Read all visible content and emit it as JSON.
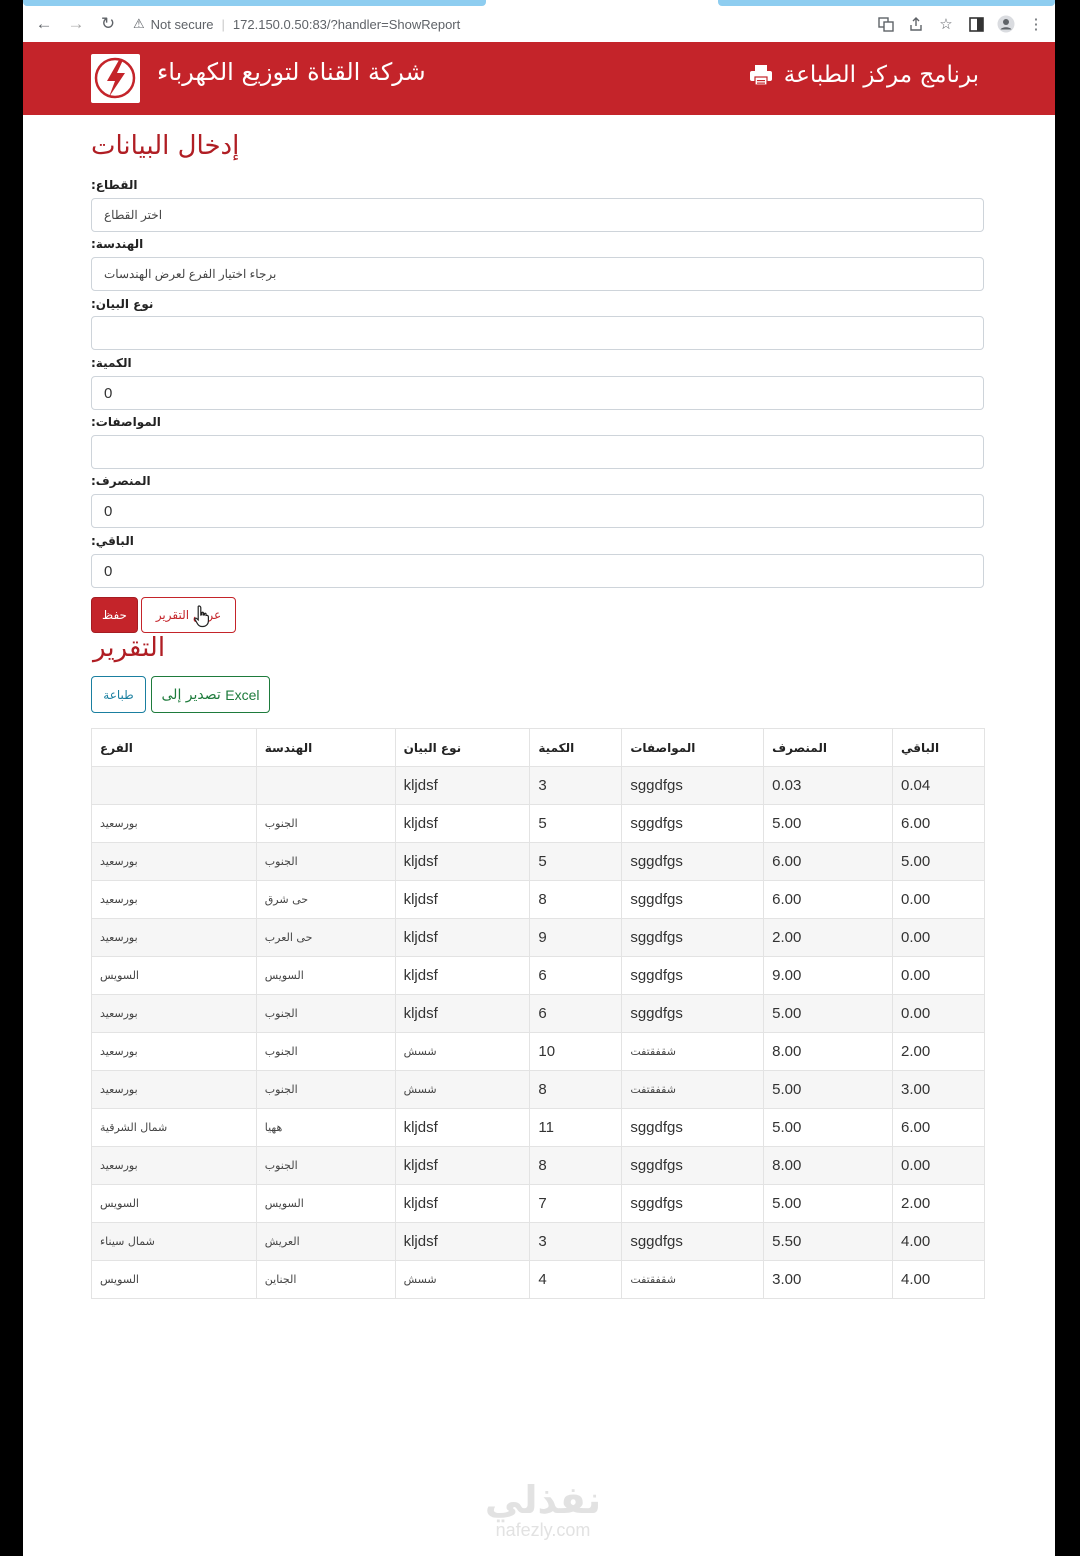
{
  "browser": {
    "security": "Not secure",
    "url": "172.150.0.50:83/?handler=ShowReport"
  },
  "header": {
    "company": "شركة القناة لتوزيع الكهرباء",
    "program": "برنامج مركز الطباعة",
    "brand_color": "#c4242a"
  },
  "form": {
    "title": "إدخال البيانات",
    "sector": {
      "label": "القطاع:",
      "value": "اختر القطاع"
    },
    "engineering": {
      "label": "الهندسة:",
      "value": "برجاء اختيار الفرع لعرض الهندسات"
    },
    "data_type": {
      "label": "نوع البيان:",
      "value": ""
    },
    "quantity": {
      "label": "الكمية:",
      "value": "0"
    },
    "specs": {
      "label": "المواصفات:",
      "value": ""
    },
    "spent": {
      "label": "المنصرف:",
      "value": "0"
    },
    "remaining": {
      "label": "الباقي:",
      "value": "0"
    },
    "save_label": "حفظ",
    "show_report_label": "عرض التقرير"
  },
  "report": {
    "title": "التقرير",
    "print_label": "طباعة",
    "export_label_en": "Excel",
    "export_label_ar": "تصدير إلى",
    "columns": [
      "الفرع",
      "الهندسة",
      "نوع البيان",
      "الكمية",
      "المواصفات",
      "المنصرف",
      "الباقي"
    ],
    "rows": [
      [
        "",
        "",
        "kljdsf",
        "3",
        "sggdfgs",
        "0.03",
        "0.04"
      ],
      [
        "بورسعيد",
        "الجنوب",
        "kljdsf",
        "5",
        "sggdfgs",
        "5.00",
        "6.00"
      ],
      [
        "بورسعيد",
        "الجنوب",
        "kljdsf",
        "5",
        "sggdfgs",
        "6.00",
        "5.00"
      ],
      [
        "بورسعيد",
        "حى شرق",
        "kljdsf",
        "8",
        "sggdfgs",
        "6.00",
        "0.00"
      ],
      [
        "بورسعيد",
        "حى العرب",
        "kljdsf",
        "9",
        "sggdfgs",
        "2.00",
        "0.00"
      ],
      [
        "السويس",
        "السويس",
        "kljdsf",
        "6",
        "sggdfgs",
        "9.00",
        "0.00"
      ],
      [
        "بورسعيد",
        "الجنوب",
        "kljdsf",
        "6",
        "sggdfgs",
        "5.00",
        "0.00"
      ],
      [
        "بورسعيد",
        "الجنوب",
        "شسش",
        "10",
        "شقفقتفت",
        "8.00",
        "2.00"
      ],
      [
        "بورسعيد",
        "الجنوب",
        "شسش",
        "8",
        "شقفقتفت",
        "5.00",
        "3.00"
      ],
      [
        "شمال الشرقية",
        "ههيا",
        "kljdsf",
        "11",
        "sggdfgs",
        "5.00",
        "6.00"
      ],
      [
        "بورسعيد",
        "الجنوب",
        "kljdsf",
        "8",
        "sggdfgs",
        "8.00",
        "0.00"
      ],
      [
        "السويس",
        "السويس",
        "kljdsf",
        "7",
        "sggdfgs",
        "5.00",
        "2.00"
      ],
      [
        "شمال سيناء",
        "العريش",
        "kljdsf",
        "3",
        "sggdfgs",
        "5.50",
        "4.00"
      ],
      [
        "السويس",
        "الجناين",
        "شسش",
        "4",
        "شقفقتفت",
        "3.00",
        "4.00"
      ]
    ]
  },
  "watermark": {
    "arabic": "نفذلي",
    "latin": "nafezly.com"
  }
}
